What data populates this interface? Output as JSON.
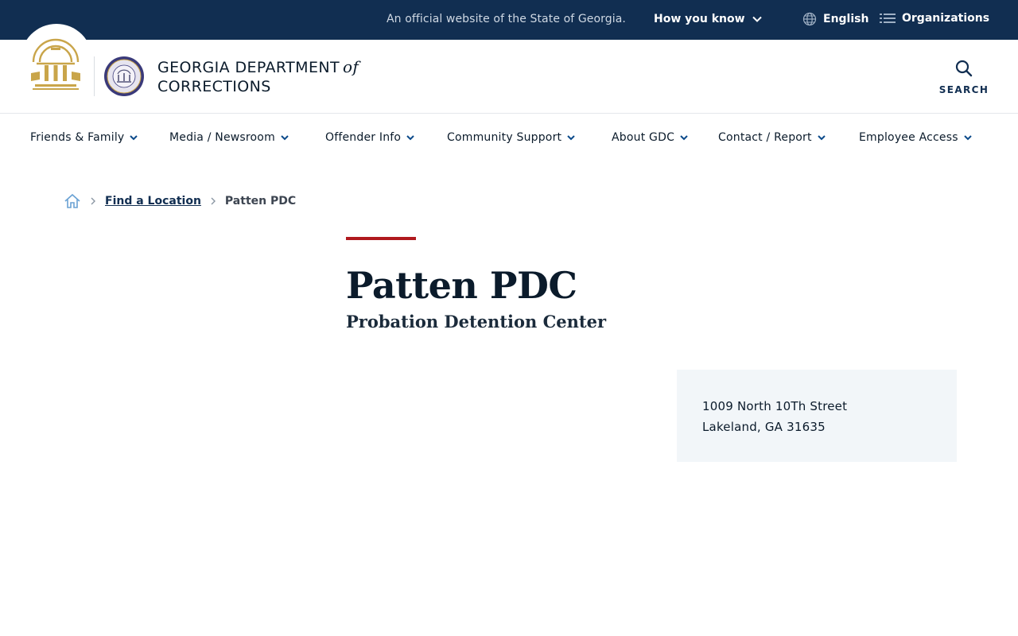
{
  "topbar": {
    "official_text": "An official website of the State of Georgia.",
    "how_you_know": "How you know",
    "language": "English",
    "organizations": "Organizations",
    "background_color": "#112e51"
  },
  "header": {
    "brand_line1": "GEORGIA DEPARTMENT",
    "brand_of": "of",
    "brand_line2": "CORRECTIONS",
    "search_label": "SEARCH"
  },
  "nav": {
    "items": [
      {
        "label": "Friends & Family"
      },
      {
        "label": "Media / Newsroom"
      },
      {
        "label": "Offender Info"
      },
      {
        "label": "Community Support"
      },
      {
        "label": "About GDC"
      },
      {
        "label": "Contact / Report"
      },
      {
        "label": "Employee Access"
      }
    ]
  },
  "breadcrumb": {
    "home_icon": "home-icon",
    "link": "Find a Location",
    "current": "Patten PDC"
  },
  "page": {
    "title": "Patten PDC",
    "subtitle": "Probation Detention Center",
    "accent_color": "#b0191e"
  },
  "address": {
    "line1": "1009 North 10Th Street",
    "line2": "Lakeland, GA 31635"
  }
}
